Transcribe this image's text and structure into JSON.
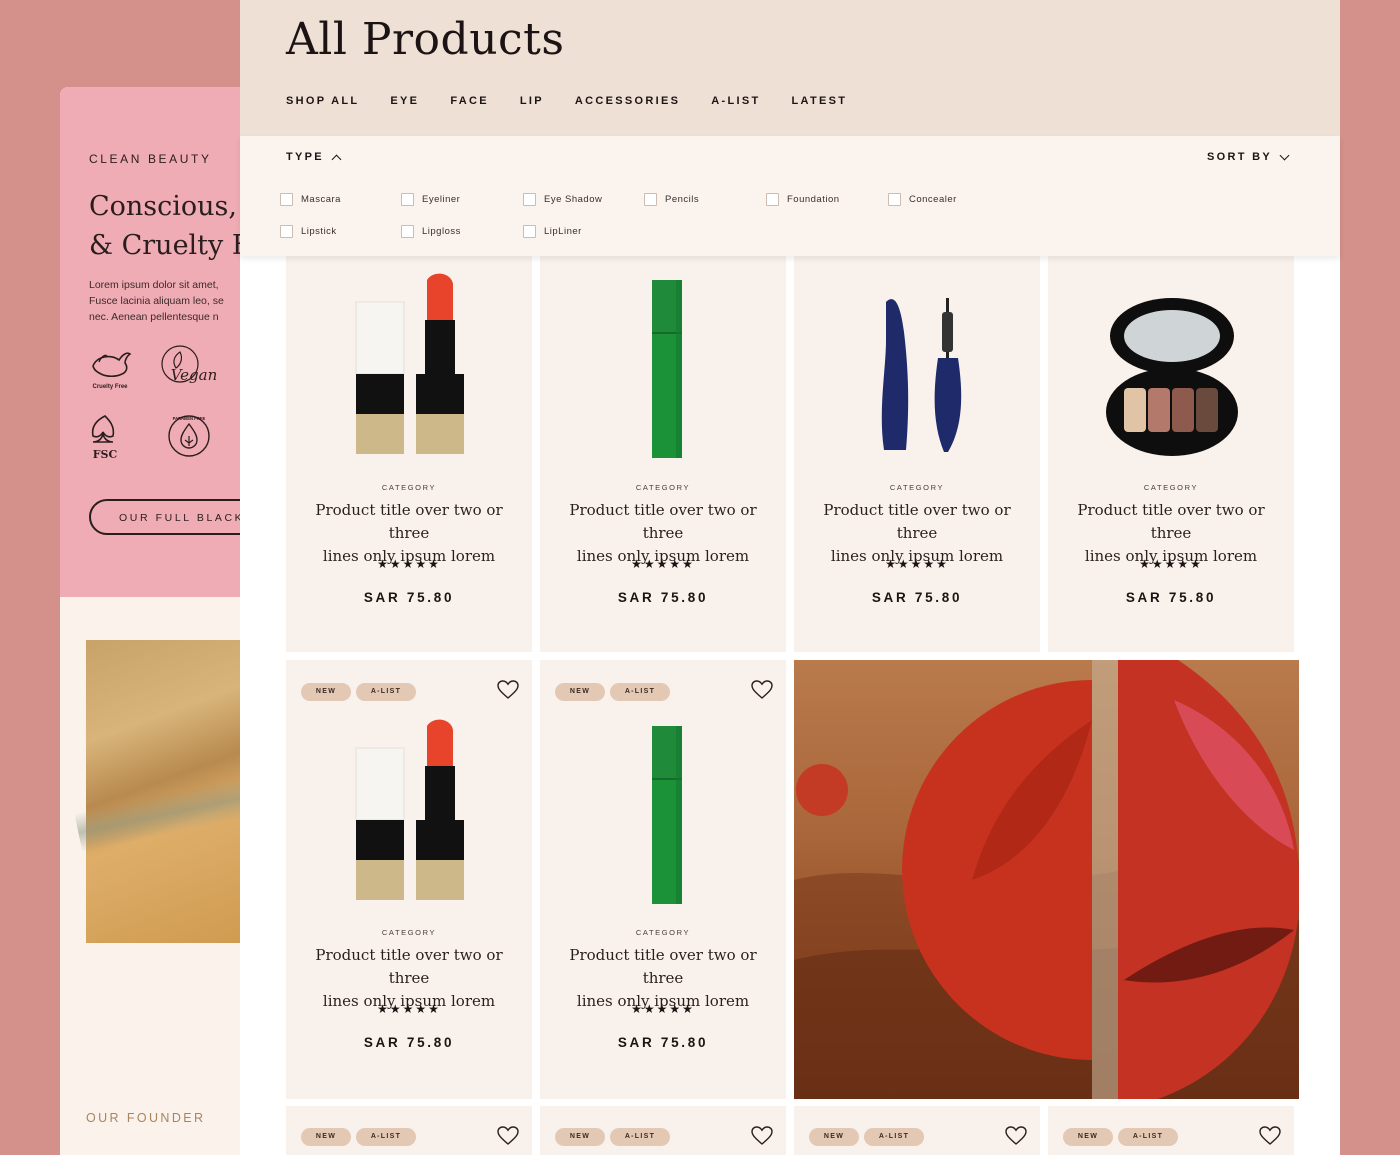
{
  "back_panel": {
    "eyebrow": "CLEAN BEAUTY",
    "headline_line1": "Conscious,",
    "headline_line2": "& Cruelty Fr",
    "body": "Lorem ipsum dolor sit amet,\nFusce lacinia aliquam leo, se\nnec. Aenean pellentesque n",
    "badges": [
      "Cruelty Free",
      "Vegan",
      "FSC",
      "PARABEN FREE"
    ],
    "blacklist_button": "OUR FULL BLACKLI",
    "founder_label": "OUR FOUNDER"
  },
  "page": {
    "title": "All Products",
    "nav": [
      "SHOP ALL",
      "EYE",
      "FACE",
      "LIP",
      "ACCESSORIES",
      "A-LIST",
      "LATEST"
    ]
  },
  "filter": {
    "type_label": "TYPE",
    "sort_label": "SORT BY",
    "options_row1": [
      "Mascara",
      "Eyeliner",
      "Eye Shadow",
      "Pencils",
      "Foundation",
      "Concealer"
    ],
    "options_row2": [
      "Lipstick",
      "Lipgloss",
      "LipLiner"
    ]
  },
  "products": [
    {
      "image": "lipstick",
      "category": "CATEGORY",
      "title": "Product title over two or three\nlines only ipsum lorem",
      "rating": 5,
      "stars": "★★★★★",
      "price": "SAR 75.80"
    },
    {
      "image": "green-tube",
      "category": "CATEGORY",
      "title": "Product title over two or three\nlines only ipsum lorem",
      "rating": 5,
      "stars": "★★★★★",
      "price": "SAR 75.80"
    },
    {
      "image": "mascara",
      "category": "CATEGORY",
      "title": "Product title over two or three\nlines only ipsum lorem",
      "rating": 5,
      "stars": "★★★★★",
      "price": "SAR 75.80"
    },
    {
      "image": "eyeshadow-palette",
      "category": "CATEGORY",
      "title": "Product title over two or three\nlines only ipsum lorem",
      "rating": 5,
      "stars": "★★★★★",
      "price": "SAR 75.80"
    },
    {
      "image": "lipstick",
      "tags": [
        "NEW",
        "A-LIST"
      ],
      "category": "CATEGORY",
      "title": "Product title over two or three\nlines only ipsum lorem",
      "rating": 5,
      "stars": "★★★★★",
      "price": "SAR 75.80"
    },
    {
      "image": "green-tube",
      "tags": [
        "NEW",
        "A-LIST"
      ],
      "category": "CATEGORY",
      "title": "Product title over two or three\nlines only ipsum lorem",
      "rating": 5,
      "stars": "★★★★★",
      "price": "SAR 75.80"
    }
  ],
  "bottom_row_tags": [
    [
      "NEW",
      "A-LIST"
    ],
    [
      "NEW",
      "A-LIST"
    ],
    [
      "NEW",
      "A-LIST"
    ],
    [
      "NEW",
      "A-LIST"
    ]
  ],
  "icons": {
    "favorite": "heart-icon",
    "chevron_up": "chevron-up-icon",
    "chevron_down": "chevron-down-icon"
  },
  "colors": {
    "background": "#d4908a",
    "header": "#efe0d5",
    "card": "#f9f1eb",
    "tag": "#e3c8b4",
    "pink": "#f0acb5"
  }
}
